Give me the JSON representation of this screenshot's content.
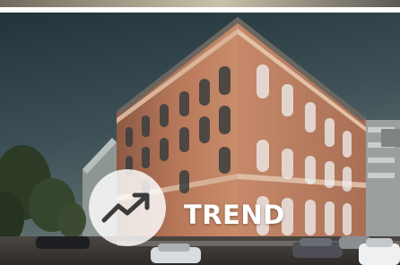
{
  "tile": {
    "label": "TREND",
    "icon": "trending-up-icon",
    "image_subject": "brick-office-building-photo"
  },
  "colors": {
    "badge_bg": "#ffffff",
    "label": "#ffffff",
    "sky": "#2f3f45",
    "brick": "#b07456"
  }
}
